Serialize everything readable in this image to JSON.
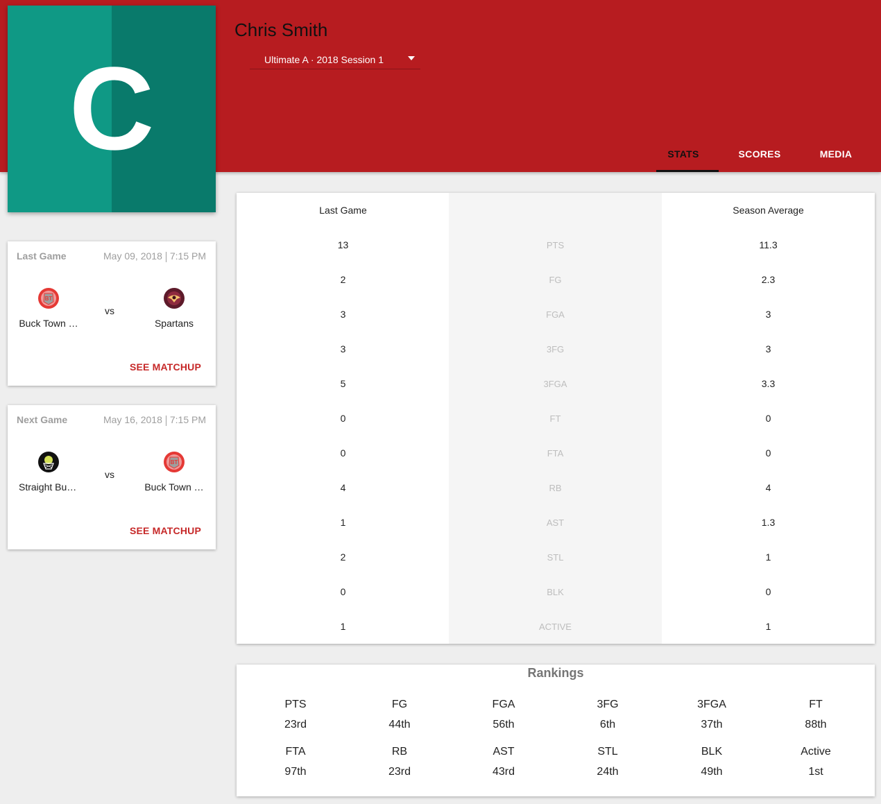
{
  "player": {
    "initial": "C",
    "name": "Chris Smith",
    "session": "Ultimate A · 2018 Session 1"
  },
  "tabs": [
    "STATS",
    "SCORES",
    "MEDIA"
  ],
  "colors": {
    "header": "#b71c20",
    "avatar": "#0f9985",
    "avatar_shade": "#097a6b",
    "accent": "#c62828"
  },
  "last_game": {
    "label": "Last Game",
    "date": "May 09, 2018",
    "time": "7:15 PM",
    "home": "Buck Town …",
    "away": "Spartans",
    "vs": "vs",
    "action": "SEE MATCHUP"
  },
  "next_game": {
    "label": "Next Game",
    "date": "May 16, 2018",
    "time": "7:15 PM",
    "home": "Straight Buc…",
    "away": "Buck Town …",
    "vs": "vs",
    "action": "SEE MATCHUP"
  },
  "stats": {
    "last_game_header": "Last Game",
    "season_header": "Season Average",
    "rows": [
      {
        "label": "PTS",
        "last": "13",
        "avg": "11.3"
      },
      {
        "label": "FG",
        "last": "2",
        "avg": "2.3"
      },
      {
        "label": "FGA",
        "last": "3",
        "avg": "3"
      },
      {
        "label": "3FG",
        "last": "3",
        "avg": "3"
      },
      {
        "label": "3FGA",
        "last": "5",
        "avg": "3.3"
      },
      {
        "label": "FT",
        "last": "0",
        "avg": "0"
      },
      {
        "label": "FTA",
        "last": "0",
        "avg": "0"
      },
      {
        "label": "RB",
        "last": "4",
        "avg": "4"
      },
      {
        "label": "AST",
        "last": "1",
        "avg": "1.3"
      },
      {
        "label": "STL",
        "last": "2",
        "avg": "1"
      },
      {
        "label": "BLK",
        "last": "0",
        "avg": "0"
      },
      {
        "label": "ACTIVE",
        "last": "1",
        "avg": "1"
      }
    ]
  },
  "rankings": {
    "title": "Rankings",
    "items": [
      {
        "label": "PTS",
        "value": "23rd"
      },
      {
        "label": "FG",
        "value": "44th"
      },
      {
        "label": "FGA",
        "value": "56th"
      },
      {
        "label": "3FG",
        "value": "6th"
      },
      {
        "label": "3FGA",
        "value": "37th"
      },
      {
        "label": "FT",
        "value": "88th"
      },
      {
        "label": "FTA",
        "value": "97th"
      },
      {
        "label": "RB",
        "value": "23rd"
      },
      {
        "label": "AST",
        "value": "43rd"
      },
      {
        "label": "STL",
        "value": "24th"
      },
      {
        "label": "BLK",
        "value": "49th"
      },
      {
        "label": "Active",
        "value": "1st"
      }
    ]
  }
}
